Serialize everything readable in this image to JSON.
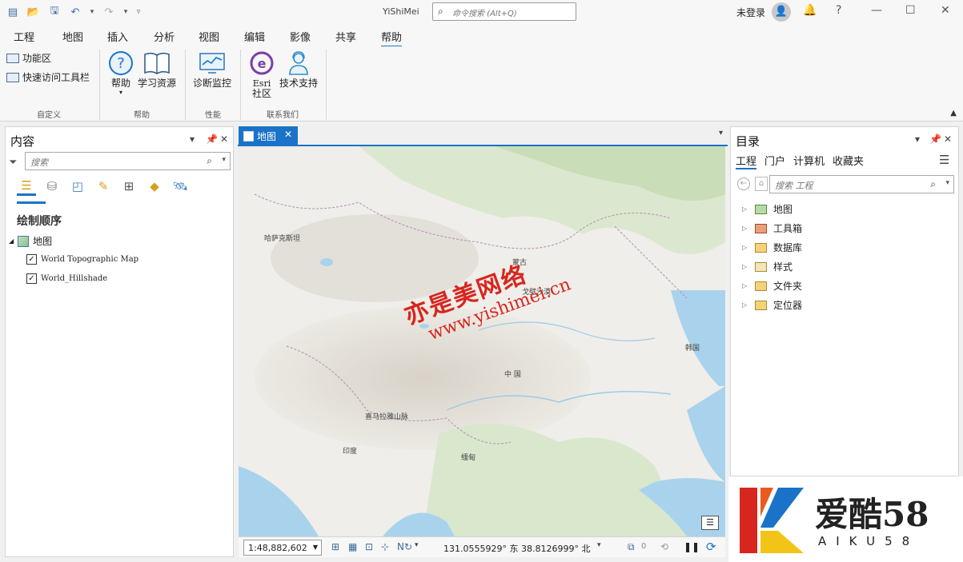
{
  "app": {
    "title": "YiShiMei",
    "command_search_placeholder": "命令搜索 (Alt+Q)",
    "sign_in": "未登录"
  },
  "ribbon_tabs": [
    "工程",
    "地图",
    "插入",
    "分析",
    "视图",
    "编辑",
    "影像",
    "共享",
    "帮助"
  ],
  "active_tab": "帮助",
  "ribbon": {
    "customize": {
      "ribbon_item": "功能区",
      "qat_item": "快速访问工具栏",
      "group_label": "自定义"
    },
    "help": {
      "help_button": "帮助",
      "learning_button": "学习资源",
      "group_label": "帮助"
    },
    "performance": {
      "diagnostic_button": "诊断监控",
      "group_label": "性能"
    },
    "contact": {
      "esri_line1": "Esri",
      "esri_line2": "社区",
      "support_button": "技术支持",
      "group_label": "联系我们"
    }
  },
  "contents_pane": {
    "title": "内容",
    "search_placeholder": "搜索",
    "draw_order_label": "绘制顺序",
    "map_name": "地图",
    "layers": [
      {
        "name": "World Topographic Map",
        "checked": true
      },
      {
        "name": "World_Hillshade",
        "checked": true
      }
    ]
  },
  "map_view": {
    "tab_label": "地图",
    "labels": {
      "kazakhstan": "哈萨克斯坦",
      "mongolia": "蒙古",
      "gobi": "戈壁沙漠",
      "china": "中 国",
      "korea": "韩国",
      "himalaya": "喜马拉雅山脉",
      "india": "印度",
      "myanmar": "缅甸"
    },
    "watermark_line1": "亦是美网络",
    "watermark_line2": "www.yishimei.cn",
    "scale": "1:48,882,602",
    "coordinates": "131.0555929° 东  38.8126999° 北",
    "selected_count": "0"
  },
  "catalog_pane": {
    "title": "目录",
    "tabs": [
      "工程",
      "门户",
      "计算机",
      "收藏夹"
    ],
    "search_placeholder": "搜索 工程",
    "items": [
      "地图",
      "工具箱",
      "数据库",
      "样式",
      "文件夹",
      "定位器"
    ]
  },
  "corner_watermark": {
    "name": "爱酷58",
    "sub": "AIKU58"
  },
  "colors": {
    "accent": "#1a73c8",
    "watermark_red": "#d7261e"
  }
}
